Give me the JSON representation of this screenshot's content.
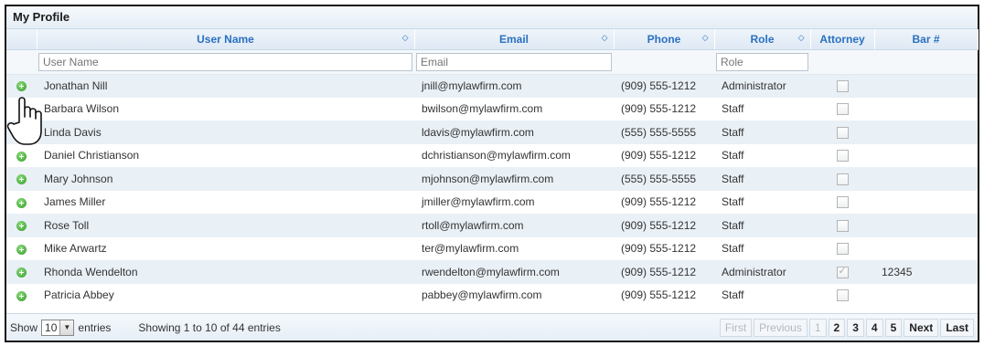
{
  "panel": {
    "title": "My Profile"
  },
  "columns": {
    "user_name": "User Name",
    "email": "Email",
    "phone": "Phone",
    "role": "Role",
    "attorney": "Attorney",
    "bar": "Bar #"
  },
  "filters": {
    "user_name_placeholder": "User Name",
    "email_placeholder": "Email",
    "role_placeholder": "Role"
  },
  "rows": [
    {
      "name": "Jonathan Nill",
      "email": "jnill@mylawfirm.com",
      "phone": "(909) 555-1212",
      "role": "Administrator",
      "attorney": false,
      "bar": ""
    },
    {
      "name": "Barbara Wilson",
      "email": "bwilson@mylawfirm.com",
      "phone": "(909) 555-1212",
      "role": "Staff",
      "attorney": false,
      "bar": ""
    },
    {
      "name": "Linda Davis",
      "email": "ldavis@mylawfirm.com",
      "phone": "(555) 555-5555",
      "role": "Staff",
      "attorney": false,
      "bar": ""
    },
    {
      "name": "Daniel Christianson",
      "email": "dchristianson@mylawfirm.com",
      "phone": "(909) 555-1212",
      "role": "Staff",
      "attorney": false,
      "bar": ""
    },
    {
      "name": "Mary Johnson",
      "email": "mjohnson@mylawfirm.com",
      "phone": "(555) 555-5555",
      "role": "Staff",
      "attorney": false,
      "bar": ""
    },
    {
      "name": "James Miller",
      "email": "jmiller@mylawfirm.com",
      "phone": "(909) 555-1212",
      "role": "Staff",
      "attorney": false,
      "bar": ""
    },
    {
      "name": "Rose Toll",
      "email": "rtoll@mylawfirm.com",
      "phone": "(909) 555-1212",
      "role": "Staff",
      "attorney": false,
      "bar": ""
    },
    {
      "name": "Mike Arwartz",
      "email": "ter@mylawfirm.com",
      "phone": "(909) 555-1212",
      "role": "Staff",
      "attorney": false,
      "bar": ""
    },
    {
      "name": "Rhonda Wendelton",
      "email": "rwendelton@mylawfirm.com",
      "phone": "(909) 555-1212",
      "role": "Administrator",
      "attorney": true,
      "bar": "12345"
    },
    {
      "name": "Patricia Abbey",
      "email": "pabbey@mylawfirm.com",
      "phone": "(909) 555-1212",
      "role": "Staff",
      "attorney": false,
      "bar": ""
    }
  ],
  "footer": {
    "show_label": "Show",
    "page_size": "10",
    "entries_label": "entries",
    "info": "Showing 1 to 10 of 44 entries",
    "first": "First",
    "previous": "Previous",
    "pages": [
      "1",
      "2",
      "3",
      "4",
      "5"
    ],
    "next": "Next",
    "last": "Last"
  },
  "icons": {
    "expand": "plus-circle-icon",
    "sort": "sort-icon",
    "cursor": "hand-pointer-icon"
  },
  "colors": {
    "header_text": "#2a70c0",
    "row_alt": "#e9f0f6",
    "expand_green": "#2f9a26"
  }
}
